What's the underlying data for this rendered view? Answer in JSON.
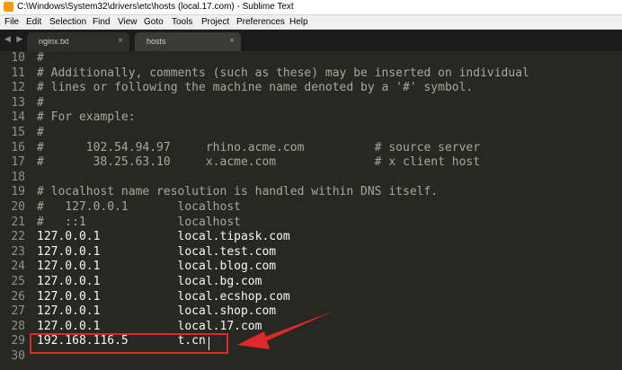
{
  "window": {
    "title": "C:\\Windows\\System32\\drivers\\etc\\hosts (local.17.com) - Sublime Text"
  },
  "menu": [
    "File",
    "Edit",
    "Selection",
    "Find",
    "View",
    "Goto",
    "Tools",
    "Project",
    "Preferences",
    "Help"
  ],
  "tabs": [
    {
      "label": "nginx.txt",
      "close": "×",
      "active": false
    },
    {
      "label": "hosts",
      "close": "×",
      "active": true
    }
  ],
  "nav_arrows": "◀ ▶",
  "editor": {
    "lines": [
      {
        "num": "10",
        "text": "#",
        "comment": true
      },
      {
        "num": "11",
        "text": "# Additionally, comments (such as these) may be inserted on individual",
        "comment": true
      },
      {
        "num": "12",
        "text": "# lines or following the machine name denoted by a '#' symbol.",
        "comment": true
      },
      {
        "num": "13",
        "text": "#",
        "comment": true
      },
      {
        "num": "14",
        "text": "# For example:",
        "comment": true
      },
      {
        "num": "15",
        "text": "#",
        "comment": true
      },
      {
        "num": "16",
        "text": "#      102.54.94.97     rhino.acme.com          # source server",
        "comment": true
      },
      {
        "num": "17",
        "text": "#       38.25.63.10     x.acme.com              # x client host",
        "comment": true
      },
      {
        "num": "18",
        "text": "",
        "comment": false
      },
      {
        "num": "19",
        "text": "# localhost name resolution is handled within DNS itself.",
        "comment": true
      },
      {
        "num": "20",
        "text": "#   127.0.0.1       localhost",
        "comment": true
      },
      {
        "num": "21",
        "text": "#   ::1             localhost",
        "comment": true
      },
      {
        "num": "22",
        "text": "127.0.0.1           local.tipask.com",
        "comment": false
      },
      {
        "num": "23",
        "text": "127.0.0.1           local.test.com",
        "comment": false
      },
      {
        "num": "24",
        "text": "127.0.0.1           local.blog.com",
        "comment": false
      },
      {
        "num": "25",
        "text": "127.0.0.1           local.bg.com",
        "comment": false
      },
      {
        "num": "26",
        "text": "127.0.0.1           local.ecshop.com",
        "comment": false
      },
      {
        "num": "27",
        "text": "127.0.0.1           local.shop.com",
        "comment": false
      },
      {
        "num": "28",
        "text": "127.0.0.1           local.17.com",
        "comment": false
      },
      {
        "num": "29",
        "text": "192.168.116.5       t.cn",
        "comment": false
      },
      {
        "num": "30",
        "text": "",
        "comment": false
      }
    ]
  },
  "colors": {
    "background": "#272822",
    "text": "#f8f8f2",
    "line_number": "#8f908a",
    "annotation": "#e02828"
  }
}
